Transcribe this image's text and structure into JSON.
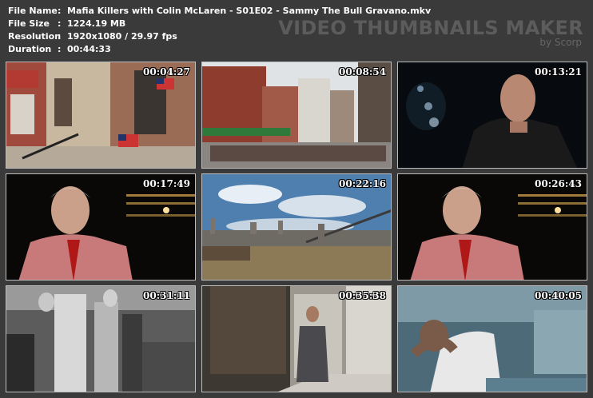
{
  "file_info": [
    {
      "label": "File Name",
      "value": "Mafia Killers with Colin McLaren - S01E02 - Sammy The Bull Gravano.mkv"
    },
    {
      "label": "File Size",
      "value": "1224.19 MB"
    },
    {
      "label": "Resolution",
      "value": "1920x1080 / 29.97 fps"
    },
    {
      "label": "Duration",
      "value": "00:44:33"
    }
  ],
  "brand": {
    "title": "VIDEO THUMBNAILS MAKER",
    "subtitle": "by Scorp"
  },
  "thumbnails": [
    {
      "timestamp": "00:04:27",
      "scene": "brownstone-street-flags"
    },
    {
      "timestamp": "00:08:54",
      "scene": "city-street-crowd"
    },
    {
      "timestamp": "00:13:21",
      "scene": "bald-man-interview-dark"
    },
    {
      "timestamp": "00:17:49",
      "scene": "older-man-interview"
    },
    {
      "timestamp": "00:22:16",
      "scene": "brooklyn-bridge-skyline"
    },
    {
      "timestamp": "00:26:43",
      "scene": "older-man-interview"
    },
    {
      "timestamp": "00:31:11",
      "scene": "black-white-archive-crowd"
    },
    {
      "timestamp": "00:35:38",
      "scene": "man-walking-sidewalk"
    },
    {
      "timestamp": "00:40:05",
      "scene": "man-head-in-hands"
    }
  ]
}
